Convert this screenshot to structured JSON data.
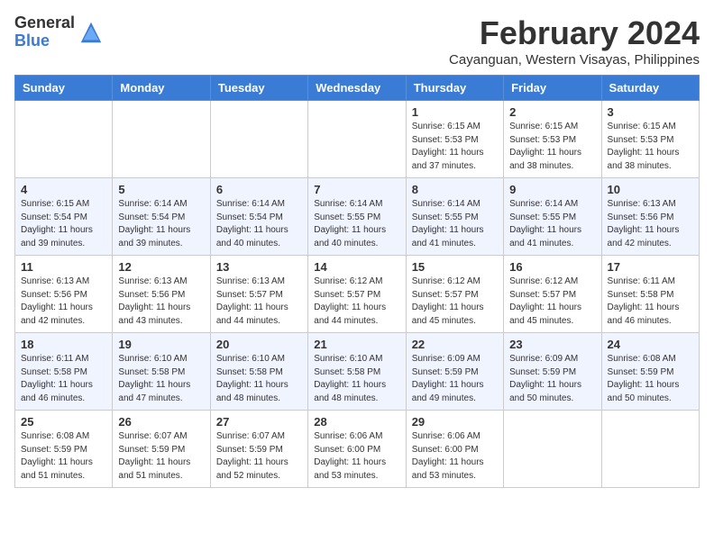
{
  "logo": {
    "general": "General",
    "blue": "Blue"
  },
  "title": "February 2024",
  "location": "Cayanguan, Western Visayas, Philippines",
  "days_header": [
    "Sunday",
    "Monday",
    "Tuesday",
    "Wednesday",
    "Thursday",
    "Friday",
    "Saturday"
  ],
  "weeks": [
    [
      {
        "day": "",
        "info": ""
      },
      {
        "day": "",
        "info": ""
      },
      {
        "day": "",
        "info": ""
      },
      {
        "day": "",
        "info": ""
      },
      {
        "day": "1",
        "info": "Sunrise: 6:15 AM\nSunset: 5:53 PM\nDaylight: 11 hours\nand 37 minutes."
      },
      {
        "day": "2",
        "info": "Sunrise: 6:15 AM\nSunset: 5:53 PM\nDaylight: 11 hours\nand 38 minutes."
      },
      {
        "day": "3",
        "info": "Sunrise: 6:15 AM\nSunset: 5:53 PM\nDaylight: 11 hours\nand 38 minutes."
      }
    ],
    [
      {
        "day": "4",
        "info": "Sunrise: 6:15 AM\nSunset: 5:54 PM\nDaylight: 11 hours\nand 39 minutes."
      },
      {
        "day": "5",
        "info": "Sunrise: 6:14 AM\nSunset: 5:54 PM\nDaylight: 11 hours\nand 39 minutes."
      },
      {
        "day": "6",
        "info": "Sunrise: 6:14 AM\nSunset: 5:54 PM\nDaylight: 11 hours\nand 40 minutes."
      },
      {
        "day": "7",
        "info": "Sunrise: 6:14 AM\nSunset: 5:55 PM\nDaylight: 11 hours\nand 40 minutes."
      },
      {
        "day": "8",
        "info": "Sunrise: 6:14 AM\nSunset: 5:55 PM\nDaylight: 11 hours\nand 41 minutes."
      },
      {
        "day": "9",
        "info": "Sunrise: 6:14 AM\nSunset: 5:55 PM\nDaylight: 11 hours\nand 41 minutes."
      },
      {
        "day": "10",
        "info": "Sunrise: 6:13 AM\nSunset: 5:56 PM\nDaylight: 11 hours\nand 42 minutes."
      }
    ],
    [
      {
        "day": "11",
        "info": "Sunrise: 6:13 AM\nSunset: 5:56 PM\nDaylight: 11 hours\nand 42 minutes."
      },
      {
        "day": "12",
        "info": "Sunrise: 6:13 AM\nSunset: 5:56 PM\nDaylight: 11 hours\nand 43 minutes."
      },
      {
        "day": "13",
        "info": "Sunrise: 6:13 AM\nSunset: 5:57 PM\nDaylight: 11 hours\nand 44 minutes."
      },
      {
        "day": "14",
        "info": "Sunrise: 6:12 AM\nSunset: 5:57 PM\nDaylight: 11 hours\nand 44 minutes."
      },
      {
        "day": "15",
        "info": "Sunrise: 6:12 AM\nSunset: 5:57 PM\nDaylight: 11 hours\nand 45 minutes."
      },
      {
        "day": "16",
        "info": "Sunrise: 6:12 AM\nSunset: 5:57 PM\nDaylight: 11 hours\nand 45 minutes."
      },
      {
        "day": "17",
        "info": "Sunrise: 6:11 AM\nSunset: 5:58 PM\nDaylight: 11 hours\nand 46 minutes."
      }
    ],
    [
      {
        "day": "18",
        "info": "Sunrise: 6:11 AM\nSunset: 5:58 PM\nDaylight: 11 hours\nand 46 minutes."
      },
      {
        "day": "19",
        "info": "Sunrise: 6:10 AM\nSunset: 5:58 PM\nDaylight: 11 hours\nand 47 minutes."
      },
      {
        "day": "20",
        "info": "Sunrise: 6:10 AM\nSunset: 5:58 PM\nDaylight: 11 hours\nand 48 minutes."
      },
      {
        "day": "21",
        "info": "Sunrise: 6:10 AM\nSunset: 5:58 PM\nDaylight: 11 hours\nand 48 minutes."
      },
      {
        "day": "22",
        "info": "Sunrise: 6:09 AM\nSunset: 5:59 PM\nDaylight: 11 hours\nand 49 minutes."
      },
      {
        "day": "23",
        "info": "Sunrise: 6:09 AM\nSunset: 5:59 PM\nDaylight: 11 hours\nand 50 minutes."
      },
      {
        "day": "24",
        "info": "Sunrise: 6:08 AM\nSunset: 5:59 PM\nDaylight: 11 hours\nand 50 minutes."
      }
    ],
    [
      {
        "day": "25",
        "info": "Sunrise: 6:08 AM\nSunset: 5:59 PM\nDaylight: 11 hours\nand 51 minutes."
      },
      {
        "day": "26",
        "info": "Sunrise: 6:07 AM\nSunset: 5:59 PM\nDaylight: 11 hours\nand 51 minutes."
      },
      {
        "day": "27",
        "info": "Sunrise: 6:07 AM\nSunset: 5:59 PM\nDaylight: 11 hours\nand 52 minutes."
      },
      {
        "day": "28",
        "info": "Sunrise: 6:06 AM\nSunset: 6:00 PM\nDaylight: 11 hours\nand 53 minutes."
      },
      {
        "day": "29",
        "info": "Sunrise: 6:06 AM\nSunset: 6:00 PM\nDaylight: 11 hours\nand 53 minutes."
      },
      {
        "day": "",
        "info": ""
      },
      {
        "day": "",
        "info": ""
      }
    ]
  ]
}
